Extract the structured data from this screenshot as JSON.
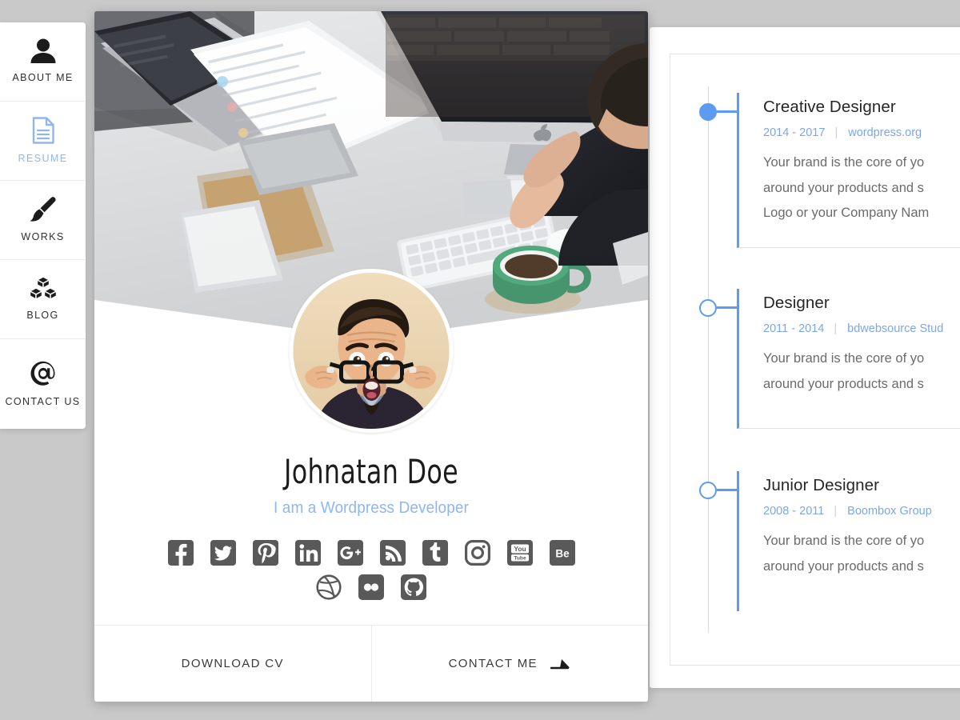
{
  "colors": {
    "page_background": "#c9c9c9",
    "accent_blue": "#5b9bf0",
    "light_blue": "#8fb6f2",
    "meta_blue": "#7ba7e8",
    "card_white": "#ffffff",
    "body_text": "#6b6b6b",
    "heading_text": "#262626"
  },
  "sidebar": {
    "items": [
      {
        "label": "ABOUT ME",
        "icon": "user-icon",
        "active": false
      },
      {
        "label": "RESUME",
        "icon": "document-icon",
        "active": true
      },
      {
        "label": "WORKS",
        "icon": "paintbrush-icon",
        "active": false
      },
      {
        "label": "BLOG",
        "icon": "cubes-icon",
        "active": false
      },
      {
        "label": "CONTACT US",
        "icon": "at-sign-icon",
        "active": false
      }
    ]
  },
  "profile": {
    "banner_alt": "man-at-desk-with-imac-and-coffee",
    "avatar_alt": "man-with-glasses-surprised-portrait",
    "name": "Johnatan Doe",
    "role": "I am a Wordpress Developer",
    "socials_row_1": [
      {
        "name": "facebook",
        "glyph": "f"
      },
      {
        "name": "twitter",
        "glyph": "t"
      },
      {
        "name": "pinterest",
        "glyph": "p"
      },
      {
        "name": "linkedin",
        "glyph": "in"
      },
      {
        "name": "google-plus",
        "glyph": "G+"
      },
      {
        "name": "rss",
        "glyph": "rss"
      },
      {
        "name": "tumblr",
        "glyph": "t"
      },
      {
        "name": "instagram",
        "glyph": "ig"
      },
      {
        "name": "youtube",
        "glyph": "You Tube"
      },
      {
        "name": "behance",
        "glyph": "Be"
      }
    ],
    "socials_row_2": [
      {
        "name": "dribbble",
        "glyph": "d"
      },
      {
        "name": "flickr",
        "glyph": "::"
      },
      {
        "name": "github",
        "glyph": "gh"
      }
    ],
    "actions": [
      {
        "label": "DOWNLOAD CV",
        "icon": null
      },
      {
        "label": "CONTACT ME",
        "icon": "arrow-right-icon"
      }
    ]
  },
  "resume": {
    "timeline": [
      {
        "title": "Creative Designer",
        "years": "2014 - 2017",
        "organization": "wordpress.org",
        "separator": "|",
        "description_lines": [
          "Your brand is the core of yo",
          "around your products and s",
          "Logo or your Company Nam"
        ],
        "marker": "filled"
      },
      {
        "title": "Designer",
        "years": "2011 - 2014",
        "organization": "bdwebsource Stud",
        "separator": "|",
        "description_lines": [
          "Your brand is the core of yo",
          "around your products and s"
        ],
        "marker": "hollow"
      },
      {
        "title": "Junior Designer",
        "years": "2008 - 2011",
        "organization": "Boombox Group",
        "separator": "|",
        "description_lines": [
          "Your brand is the core of yo",
          "around your products and s"
        ],
        "marker": "hollow"
      }
    ]
  }
}
